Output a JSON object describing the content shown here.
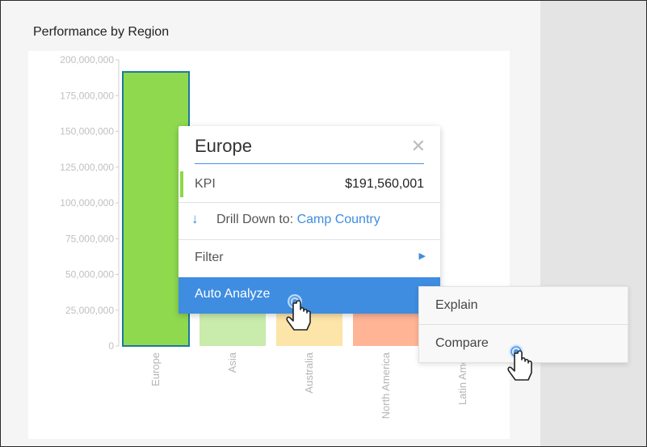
{
  "chart": {
    "title": "Performance by Region"
  },
  "chart_data": {
    "type": "bar",
    "title": "Performance by Region",
    "xlabel": "",
    "ylabel": "",
    "ylim": [
      0,
      200000000
    ],
    "y_ticks": [
      "200,000,000",
      "175,000,000",
      "150,000,000",
      "125,000,000",
      "100,000,000",
      "75,000,000",
      "50,000,000",
      "25,000,000",
      "0"
    ],
    "y_tick_values": [
      200000000,
      175000000,
      150000000,
      125000000,
      100000000,
      75000000,
      50000000,
      25000000,
      0
    ],
    "categories": [
      "Europe",
      "Asia",
      "Australia",
      "North America",
      "Latin America"
    ],
    "category_labels_visible": [
      "Europe",
      "Asia",
      "Australia",
      "North America",
      "Latin Ameri"
    ],
    "values": [
      191560001,
      47000000,
      38000000,
      35000000,
      28000000
    ],
    "bar_colors": [
      "#8fd94f",
      "#c9ebab",
      "#fde4a8",
      "#ffb495",
      "#c7dcf2"
    ],
    "grid": false
  },
  "popup": {
    "title": "Europe",
    "close_icon": "close-icon",
    "kpi_label": "KPI",
    "kpi_value": "$191,560,001",
    "drill_prefix": "Drill Down to: ",
    "drill_target": "Camp Country",
    "filter_label": "Filter",
    "auto_analyze_label": "Auto Analyze"
  },
  "submenu": {
    "explain_label": "Explain",
    "compare_label": "Compare"
  },
  "colors": {
    "accent": "#3e8de0",
    "europe_bar": "#8fd94f",
    "selected_outline": "#1b7a9b"
  }
}
